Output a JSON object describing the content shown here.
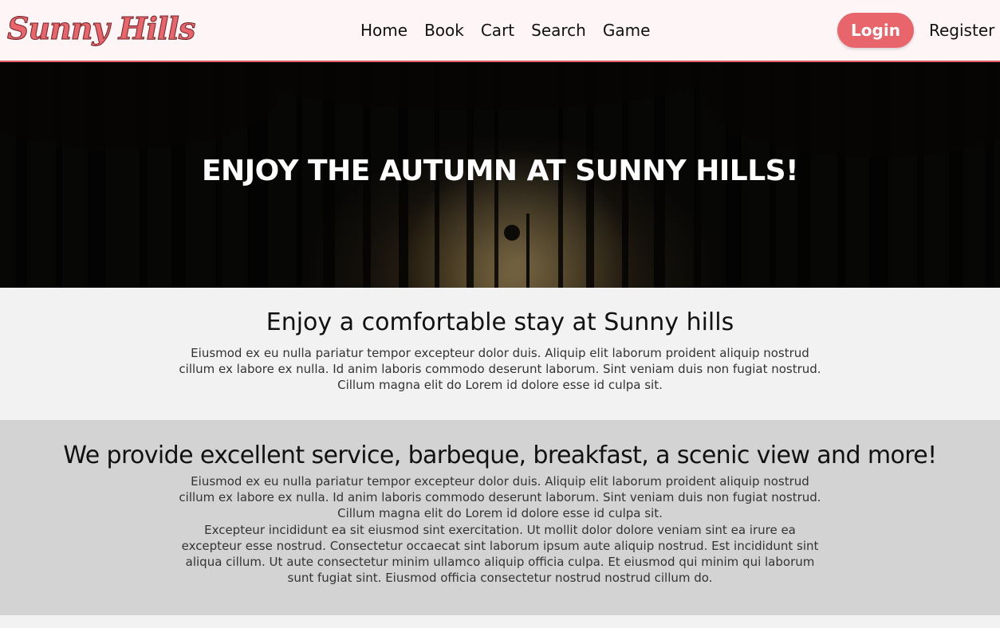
{
  "header": {
    "logo_text": "Sunny Hills",
    "nav": [
      {
        "label": "Home"
      },
      {
        "label": "Book"
      },
      {
        "label": "Cart"
      },
      {
        "label": "Search"
      },
      {
        "label": "Game"
      }
    ],
    "login_label": "Login",
    "register_label": "Register",
    "accent_color": "#e8656b"
  },
  "hero": {
    "title": "ENJOY THE AUTUMN AT SUNNY HILLS!"
  },
  "section1": {
    "heading": "Enjoy a comfortable stay at Sunny hills",
    "paragraph": "Eiusmod ex eu nulla pariatur tempor excepteur dolor duis. Aliquip elit laborum proident aliquip nostrud cillum ex labore ex nulla. Id anim laboris commodo deserunt laborum. Sint veniam duis non fugiat nostrud. Cillum magna elit do Lorem id dolore esse id culpa sit."
  },
  "section2": {
    "heading": "We provide excellent service, barbeque, breakfast, a scenic view and more!",
    "paragraph1": "Eiusmod ex eu nulla pariatur tempor excepteur dolor duis. Aliquip elit laborum proident aliquip nostrud cillum ex labore ex nulla. Id anim laboris commodo deserunt laborum. Sint veniam duis non fugiat nostrud. Cillum magna elit do Lorem id dolore esse id culpa sit.",
    "paragraph2": "Excepteur incididunt ea sit eiusmod sint exercitation. Ut mollit dolor dolore veniam sint ea irure ea excepteur esse nostrud. Consectetur occaecat sint laborum ipsum aute aliquip nostrud. Est incididunt sint aliqua cillum. Ut aute consectetur minim ullamco aliquip officia culpa. Et eiusmod qui minim qui laborum sunt fugiat sint. Eiusmod officia consectetur nostrud nostrud cillum do."
  }
}
